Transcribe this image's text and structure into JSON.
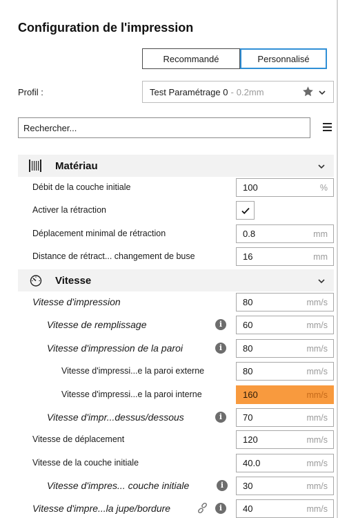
{
  "panel": {
    "title": "Configuration de l'impression"
  },
  "mode": {
    "recommended": "Recommandé",
    "custom": "Personnalisé",
    "active": "custom"
  },
  "profile": {
    "label": "Profil :",
    "name": "Test Paramétrage 0",
    "separator": "-",
    "variant": "0.2mm"
  },
  "search": {
    "placeholder": "Rechercher..."
  },
  "categories": {
    "materiau": {
      "label": "Matériau",
      "icon": "material-spool-icon"
    },
    "vitesse": {
      "label": "Vitesse",
      "icon": "speedometer-icon"
    }
  },
  "materiau_settings": [
    {
      "label": "Débit de la couche initiale",
      "value": "100",
      "unit": "%"
    },
    {
      "label": "Activer la rétraction",
      "checked": true
    },
    {
      "label": "Déplacement minimal de rétraction",
      "value": "0.8",
      "unit": "mm"
    },
    {
      "label": "Distance de rétract... changement de buse",
      "value": "16",
      "unit": "mm"
    }
  ],
  "vitesse_settings": [
    {
      "label": "Vitesse d'impression",
      "value": "80",
      "unit": "mm/s"
    },
    {
      "label": "Vitesse de remplissage",
      "value": "60",
      "unit": "mm/s"
    },
    {
      "label": "Vitesse d'impression de la paroi",
      "value": "80",
      "unit": "mm/s"
    },
    {
      "label": "Vitesse d'impressi...e la paroi externe",
      "value": "80",
      "unit": "mm/s"
    },
    {
      "label": "Vitesse d'impressi...e la paroi interne",
      "value": "160",
      "unit": "mm/s",
      "warning": true
    },
    {
      "label": "Vitesse d'impr...dessus/dessous",
      "value": "70",
      "unit": "mm/s"
    },
    {
      "label": "Vitesse de déplacement",
      "value": "120",
      "unit": "mm/s"
    },
    {
      "label": "Vitesse de la couche initiale",
      "value": "40.0",
      "unit": "mm/s"
    },
    {
      "label": "Vitesse d'impres... couche initiale",
      "value": "30",
      "unit": "mm/s"
    },
    {
      "label": "Vitesse d'impre...la jupe/bordure",
      "value": "40",
      "unit": "mm/s"
    }
  ],
  "colors": {
    "accent": "#2f8fd6",
    "warning": "#f89a3e",
    "category_bg": "#f2f2f2"
  }
}
